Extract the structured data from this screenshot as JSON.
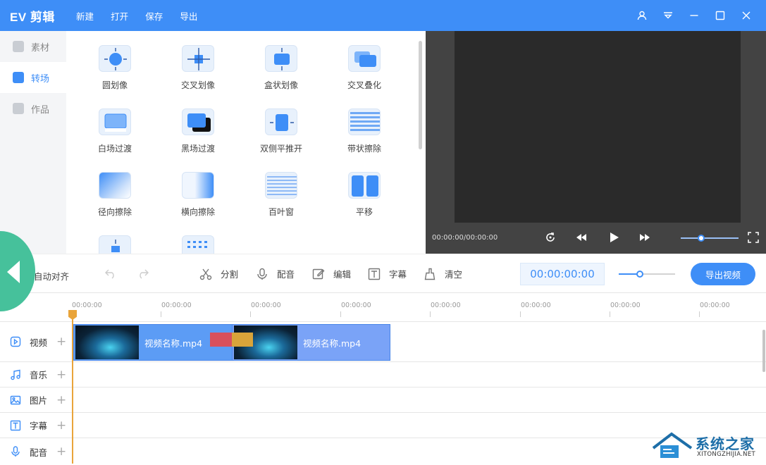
{
  "app": {
    "logo": "EV 剪辑"
  },
  "menu": [
    "新建",
    "打开",
    "保存",
    "导出"
  ],
  "window_controls": [
    "user-icon",
    "settings-menu-icon",
    "minimize-icon",
    "maximize-icon",
    "close-icon"
  ],
  "sidebar": {
    "items": [
      {
        "label": "素材",
        "active": false
      },
      {
        "label": "转场",
        "active": true
      },
      {
        "label": "作品",
        "active": false
      }
    ]
  },
  "transitions": [
    "圆划像",
    "交叉划像",
    "盒状划像",
    "交叉叠化",
    "白场过渡",
    "黑场过渡",
    "双侧平推开",
    "带状擦除",
    "径向擦除",
    "横向擦除",
    "百叶窗",
    "平移"
  ],
  "preview": {
    "time": "00:00:00/00:00:00",
    "volume": 0.35
  },
  "toolbar": {
    "auto_align": "自动对齐",
    "split": "分割",
    "dub": "配音",
    "edit": "编辑",
    "subtitle": "字幕",
    "clear": "清空",
    "timecode": "00:00:00:00",
    "zoom": 0.35,
    "export": "导出视频"
  },
  "ruler": [
    "00:00:00",
    "00:00:00",
    "00:00:00",
    "00:00:00",
    "00:00:00",
    "00:00:00",
    "00:00:00",
    "00:00:00"
  ],
  "tracks": {
    "video": "视频",
    "music": "音乐",
    "image": "图片",
    "subtitle": "字幕",
    "dub": "配音",
    "add": "+"
  },
  "clips": [
    {
      "name": "视频名称.mp4"
    },
    {
      "name": "视频名称.mp4"
    }
  ],
  "watermark": {
    "text": "系统之家",
    "sub": "XITONGZHIJIA.NET"
  },
  "colors": {
    "accent": "#3e8ef7",
    "preview_bg": "#434343",
    "playhead": "#e9a43a"
  }
}
